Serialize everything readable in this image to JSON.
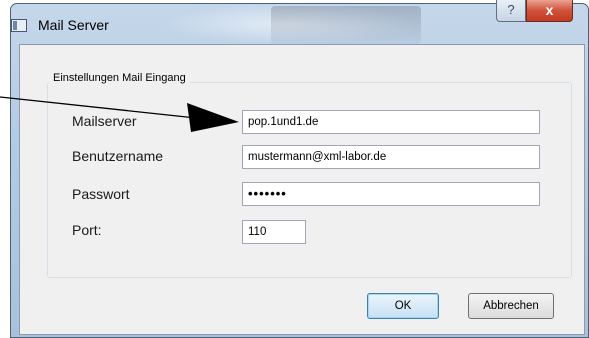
{
  "window": {
    "title": "Mail Server",
    "help_label": "?",
    "close_label": "x"
  },
  "group": {
    "label": "Einstellungen Mail Eingang"
  },
  "fields": {
    "mailserver": {
      "label": "Mailserver",
      "value": "pop.1und1.de"
    },
    "username": {
      "label": "Benutzername",
      "value": "mustermann@xml-labor.de"
    },
    "password": {
      "label": "Passwort",
      "value": "•••••••"
    },
    "port": {
      "label": "Port:",
      "value": "110"
    }
  },
  "buttons": {
    "ok_label": "OK",
    "cancel_label": "Abbrechen"
  },
  "colors": {
    "close_button": "#c43b22",
    "titlebar": "#b4cbe4",
    "dialog_background": "#f0f0f0"
  },
  "icons": [
    "window-icon",
    "help-icon",
    "close-icon",
    "annotation-arrow"
  ]
}
